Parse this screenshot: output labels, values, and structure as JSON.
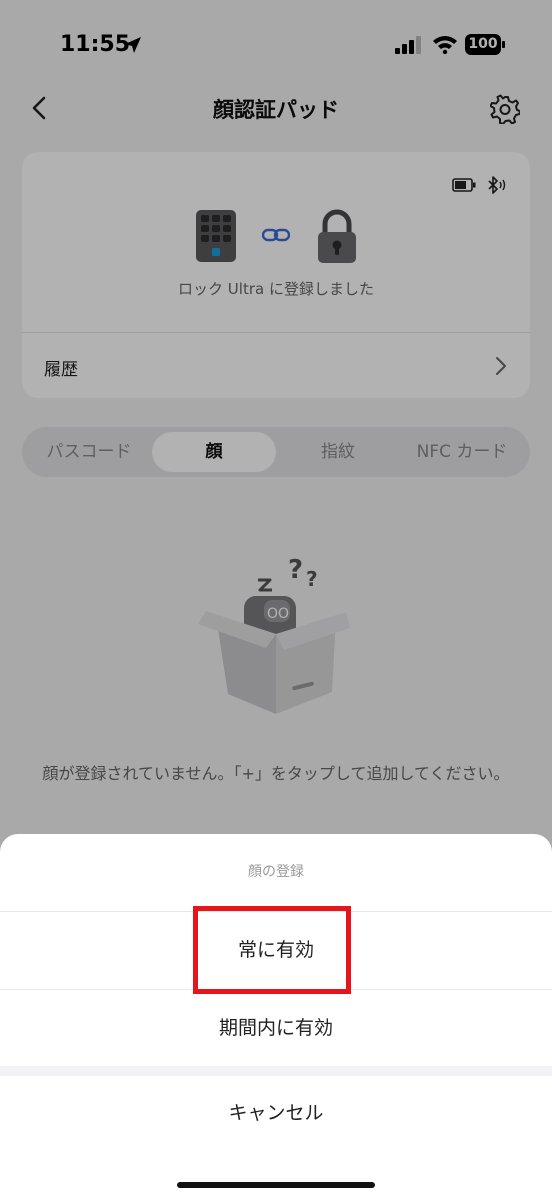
{
  "status_bar": {
    "time": "11:55",
    "battery_level": "100",
    "icons": [
      "location-arrow-icon",
      "cellular-signal-icon",
      "wifi-icon",
      "battery-icon"
    ]
  },
  "nav": {
    "title": "顔認証パッド",
    "back_icon": "chevron-left-icon",
    "settings_icon": "gear-icon"
  },
  "device_card": {
    "status_text": "ロック Ultra に登録しました",
    "history_label": "履歴",
    "icons": [
      "battery-icon",
      "bluetooth-icon",
      "keypad-icon",
      "link-icon",
      "padlock-icon",
      "chevron-right-icon"
    ]
  },
  "tabs": {
    "items": [
      {
        "label": "パスコード",
        "active": false
      },
      {
        "label": "顔",
        "active": true
      },
      {
        "label": "指紋",
        "active": false
      },
      {
        "label": "NFC カード",
        "active": false
      }
    ]
  },
  "empty_state": {
    "message": "顔が登録されていません。「+」をタップして追加してください。",
    "illustration": "empty-box-robot-icon"
  },
  "action_sheet": {
    "title": "顔の登録",
    "options": [
      {
        "label": "常に有効",
        "highlighted": true
      },
      {
        "label": "期間内に有効",
        "highlighted": false
      }
    ],
    "cancel_label": "キャンセル"
  },
  "colors": {
    "highlight_border": "#e8141b",
    "keypad_accent": "#1aa0e0",
    "link_accent": "#3b6bd6"
  }
}
